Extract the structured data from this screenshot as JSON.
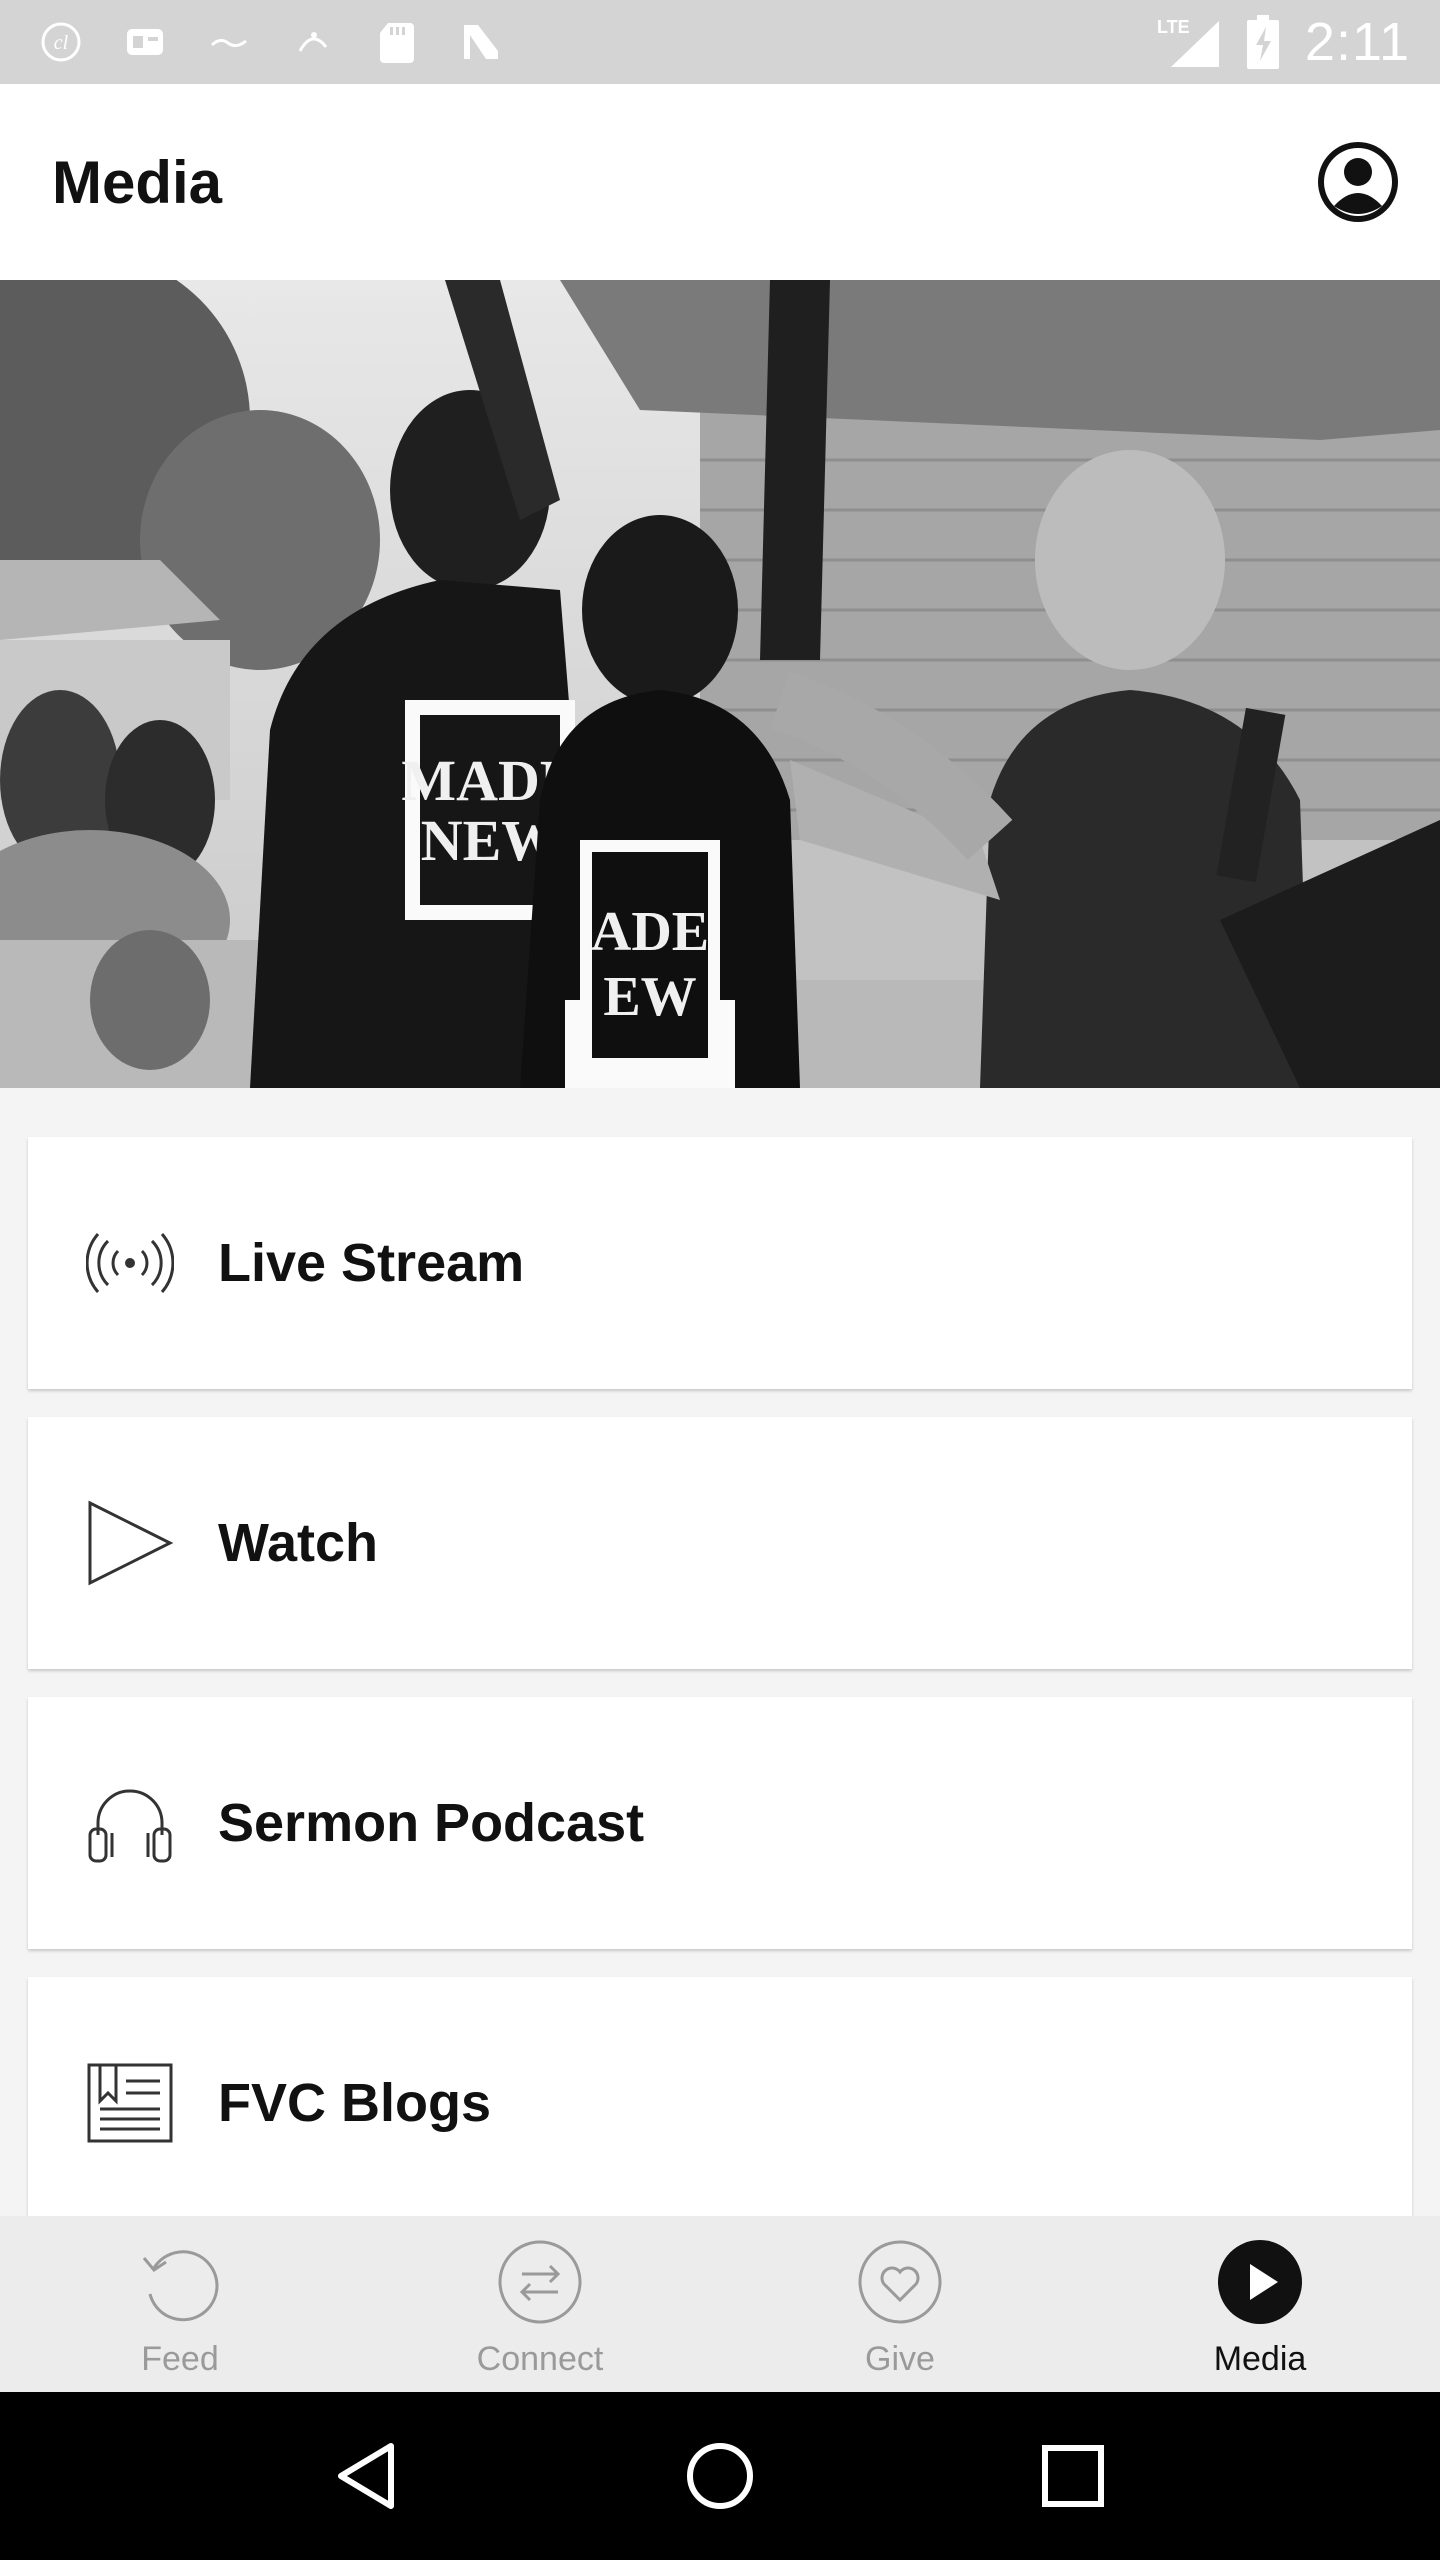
{
  "status_bar": {
    "time": "2:11",
    "network": "LTE",
    "icons": [
      "app-notification-icon",
      "game-notification-icon",
      "app-notification-icon",
      "app-notification-icon",
      "sd-card-icon",
      "n-notification-icon",
      "signal-icon",
      "battery-charging-icon"
    ]
  },
  "app_bar": {
    "title": "Media",
    "profile_icon": "profile-icon"
  },
  "hero": {
    "description_icon": "hero-photo"
  },
  "menu": {
    "items": [
      {
        "label": "Live Stream",
        "icon": "broadcast-icon"
      },
      {
        "label": "Watch",
        "icon": "play-icon"
      },
      {
        "label": "Sermon Podcast",
        "icon": "headphones-icon"
      },
      {
        "label": "FVC Blogs",
        "icon": "blog-icon"
      }
    ]
  },
  "bottom_nav": {
    "items": [
      {
        "label": "Feed",
        "icon": "feed-icon",
        "active": false
      },
      {
        "label": "Connect",
        "icon": "connect-icon",
        "active": false
      },
      {
        "label": "Give",
        "icon": "give-icon",
        "active": false
      },
      {
        "label": "Media",
        "icon": "media-icon",
        "active": true
      }
    ]
  },
  "colors": {
    "status_bar": "#d4d4d4",
    "app_bar": "#ffffff",
    "background": "#f4f4f4",
    "nav_inactive": "#9a9a9a",
    "nav_active": "#111111",
    "system_nav": "#000000"
  }
}
